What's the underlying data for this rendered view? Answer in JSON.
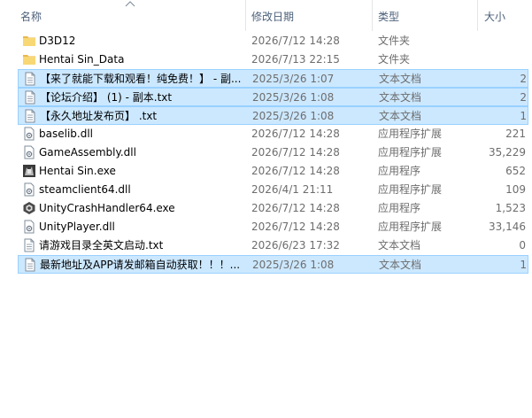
{
  "columns": {
    "name": "名称",
    "date": "修改日期",
    "type": "类型",
    "size": "大小"
  },
  "files": [
    {
      "name": "D3D12",
      "date": "2026/7/12 14:28",
      "type": "文件夹",
      "size": "",
      "icon": "folder-icon",
      "selected": false
    },
    {
      "name": "Hentai Sin_Data",
      "date": "2026/7/13 22:15",
      "type": "文件夹",
      "size": "",
      "icon": "folder-icon",
      "selected": false
    },
    {
      "name": "【来了就能下载和观看！纯免费！】 - 副...",
      "date": "2025/3/26 1:07",
      "type": "文本文档",
      "size": "2",
      "icon": "text-file-icon",
      "selected": true
    },
    {
      "name": "【论坛介绍】 (1) - 副本.txt",
      "date": "2025/3/26 1:08",
      "type": "文本文档",
      "size": "2",
      "icon": "text-file-icon",
      "selected": true
    },
    {
      "name": "【永久地址发布页】 .txt",
      "date": "2025/3/26 1:08",
      "type": "文本文档",
      "size": "1",
      "icon": "text-file-icon",
      "selected": true
    },
    {
      "name": "baselib.dll",
      "date": "2026/7/12 14:28",
      "type": "应用程序扩展",
      "size": "221",
      "icon": "dll-icon",
      "selected": false
    },
    {
      "name": "GameAssembly.dll",
      "date": "2026/7/12 14:28",
      "type": "应用程序扩展",
      "size": "35,229",
      "icon": "dll-icon",
      "selected": false
    },
    {
      "name": "Hentai Sin.exe",
      "date": "2026/7/12 14:28",
      "type": "应用程序",
      "size": "652",
      "icon": "app-icon",
      "selected": false
    },
    {
      "name": "steamclient64.dll",
      "date": "2026/4/1 21:11",
      "type": "应用程序扩展",
      "size": "109",
      "icon": "dll-icon",
      "selected": false
    },
    {
      "name": "UnityCrashHandler64.exe",
      "date": "2026/7/12 14:28",
      "type": "应用程序",
      "size": "1,523",
      "icon": "unity-icon",
      "selected": false
    },
    {
      "name": "UnityPlayer.dll",
      "date": "2026/7/12 14:28",
      "type": "应用程序扩展",
      "size": "33,146",
      "icon": "dll-icon",
      "selected": false
    },
    {
      "name": "请游戏目录全英文启动.txt",
      "date": "2026/6/23 17:32",
      "type": "文本文档",
      "size": "0",
      "icon": "text-file-icon",
      "selected": false
    },
    {
      "name": "最新地址及APP请发邮箱自动获取！！！...",
      "date": "2025/3/26 1:08",
      "type": "文本文档",
      "size": "1",
      "icon": "text-file-icon",
      "selected": true
    }
  ],
  "colors": {
    "header_text": "#4c607a",
    "selection_bg": "#cce8ff",
    "selection_border": "#99d1ff",
    "folder": "#f8d775"
  }
}
